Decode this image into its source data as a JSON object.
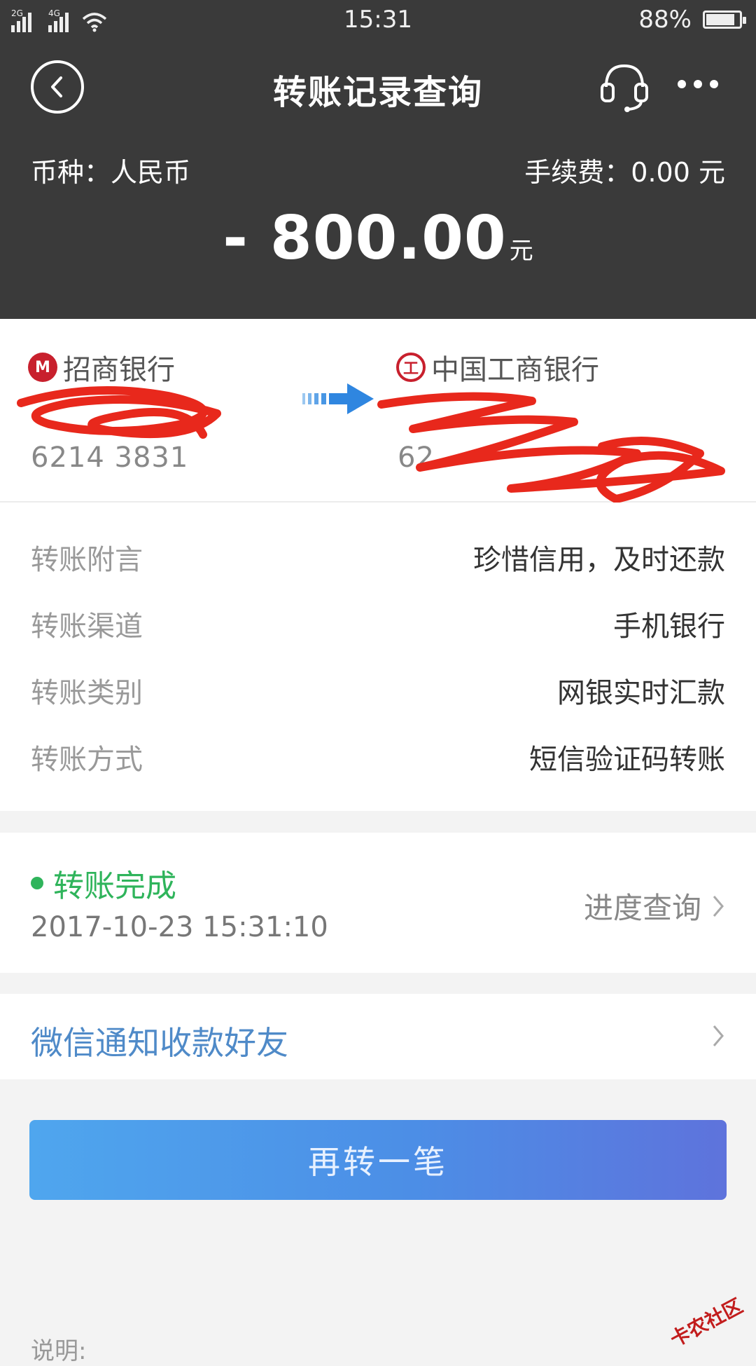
{
  "status_bar": {
    "network_left": "2G",
    "network_right": "4G",
    "time": "15:31",
    "battery": "88%",
    "battery_level": 0.88
  },
  "header": {
    "title": "转账记录查询",
    "currency_label": "币种：人民币",
    "fee_label": "手续费：0.00 元",
    "amount": "- 800.00",
    "amount_unit": "元"
  },
  "transfer": {
    "from_bank": "招商银行",
    "from_account": "6214    3831",
    "to_bank": "中国工商银行",
    "to_account": "62"
  },
  "details": [
    {
      "key": "转账附言",
      "value": "珍惜信用，及时还款"
    },
    {
      "key": "转账渠道",
      "value": "手机银行"
    },
    {
      "key": "转账类别",
      "value": "网银实时汇款"
    },
    {
      "key": "转账方式",
      "value": "短信验证码转账"
    }
  ],
  "status": {
    "label": "转账完成",
    "time": "2017-10-23 15:31:10",
    "progress_link": "进度查询"
  },
  "wechat_notify": "微信通知收款好友",
  "again_button": "再转一笔",
  "note_label": "说明:",
  "watermark": "卡农社区",
  "colors": {
    "header_bg": "#3a3a3a",
    "success": "#2fb45b",
    "link": "#4f8ac8",
    "button_start": "#4fa6ee",
    "button_end": "#5e73dc",
    "cmb_red": "#c8202d"
  }
}
